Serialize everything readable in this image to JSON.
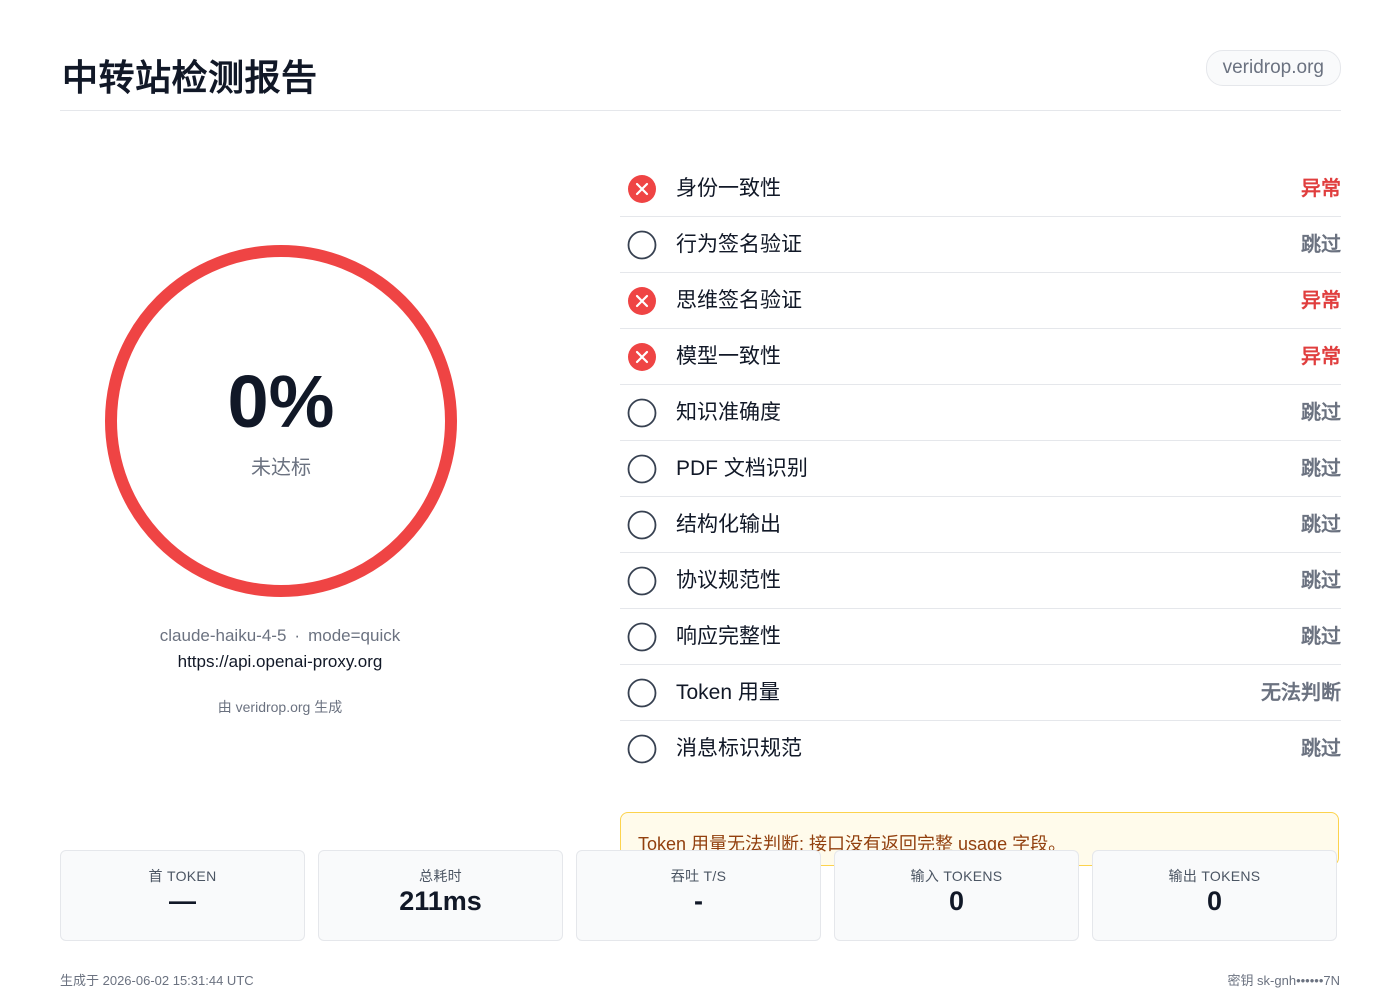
{
  "header": {
    "title": "中转站检测报告",
    "domain": "veridrop.org"
  },
  "score": {
    "value": "0%",
    "label": "未达标",
    "fraction": 0,
    "ring_color": "#ef4444"
  },
  "meta": {
    "model": "claude-haiku-4-5",
    "separator": "·",
    "mode": "mode=quick",
    "url": "https://api.openai-proxy.org",
    "generated_by": "由 veridrop.org 生成"
  },
  "checks": [
    {
      "name": "身份一致性",
      "status": "异常",
      "state": "fail"
    },
    {
      "name": "行为签名验证",
      "status": "跳过",
      "state": "skip"
    },
    {
      "name": "思维签名验证",
      "status": "异常",
      "state": "fail"
    },
    {
      "name": "模型一致性",
      "status": "异常",
      "state": "fail"
    },
    {
      "name": "知识准确度",
      "status": "跳过",
      "state": "skip"
    },
    {
      "name": "PDF 文档识别",
      "status": "跳过",
      "state": "skip"
    },
    {
      "name": "结构化输出",
      "status": "跳过",
      "state": "skip"
    },
    {
      "name": "协议规范性",
      "status": "跳过",
      "state": "skip"
    },
    {
      "name": "响应完整性",
      "status": "跳过",
      "state": "skip"
    },
    {
      "name": "Token 用量",
      "status": "无法判断",
      "state": "skip"
    },
    {
      "name": "消息标识规范",
      "status": "跳过",
      "state": "skip"
    }
  ],
  "notice": {
    "text": "Token 用量无法判断: 接口没有返回完整 usage 字段。"
  },
  "stats": [
    {
      "label": "首 TOKEN",
      "value": "—"
    },
    {
      "label": "总耗时",
      "value": "211ms"
    },
    {
      "label": "吞吐 T/S",
      "value": "-"
    },
    {
      "label": "输入 TOKENS",
      "value": "0"
    },
    {
      "label": "输出 TOKENS",
      "value": "0"
    }
  ],
  "footer": {
    "generated_at": "生成于 2026-06-02 15:31:44 UTC",
    "key": "密钥 sk-gnh••••••7N"
  },
  "colors": {
    "fail": "#e03e3e",
    "skip": "#6b7280",
    "fail_icon": "#ef4444"
  },
  "icons": {
    "fail": "x-circle-icon",
    "skip": "empty-circle-icon"
  }
}
